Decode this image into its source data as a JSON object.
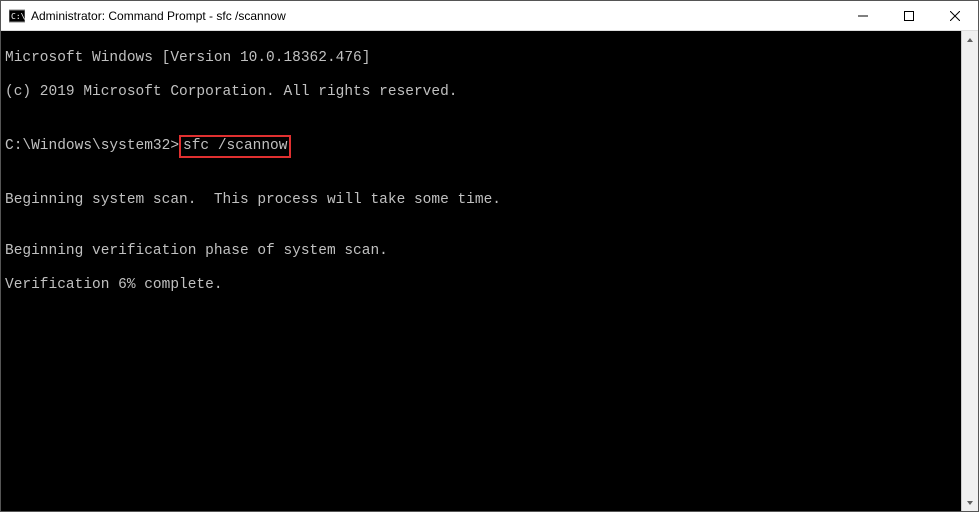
{
  "window": {
    "title": "Administrator: Command Prompt - sfc  /scannow"
  },
  "terminal": {
    "line1": "Microsoft Windows [Version 10.0.18362.476]",
    "line2": "(c) 2019 Microsoft Corporation. All rights reserved.",
    "blank1": "",
    "prompt": "C:\\Windows\\system32>",
    "command": "sfc /scannow",
    "blank2": "",
    "line3": "Beginning system scan.  This process will take some time.",
    "blank3": "",
    "line4": "Beginning verification phase of system scan.",
    "line5": "Verification 6% complete."
  }
}
